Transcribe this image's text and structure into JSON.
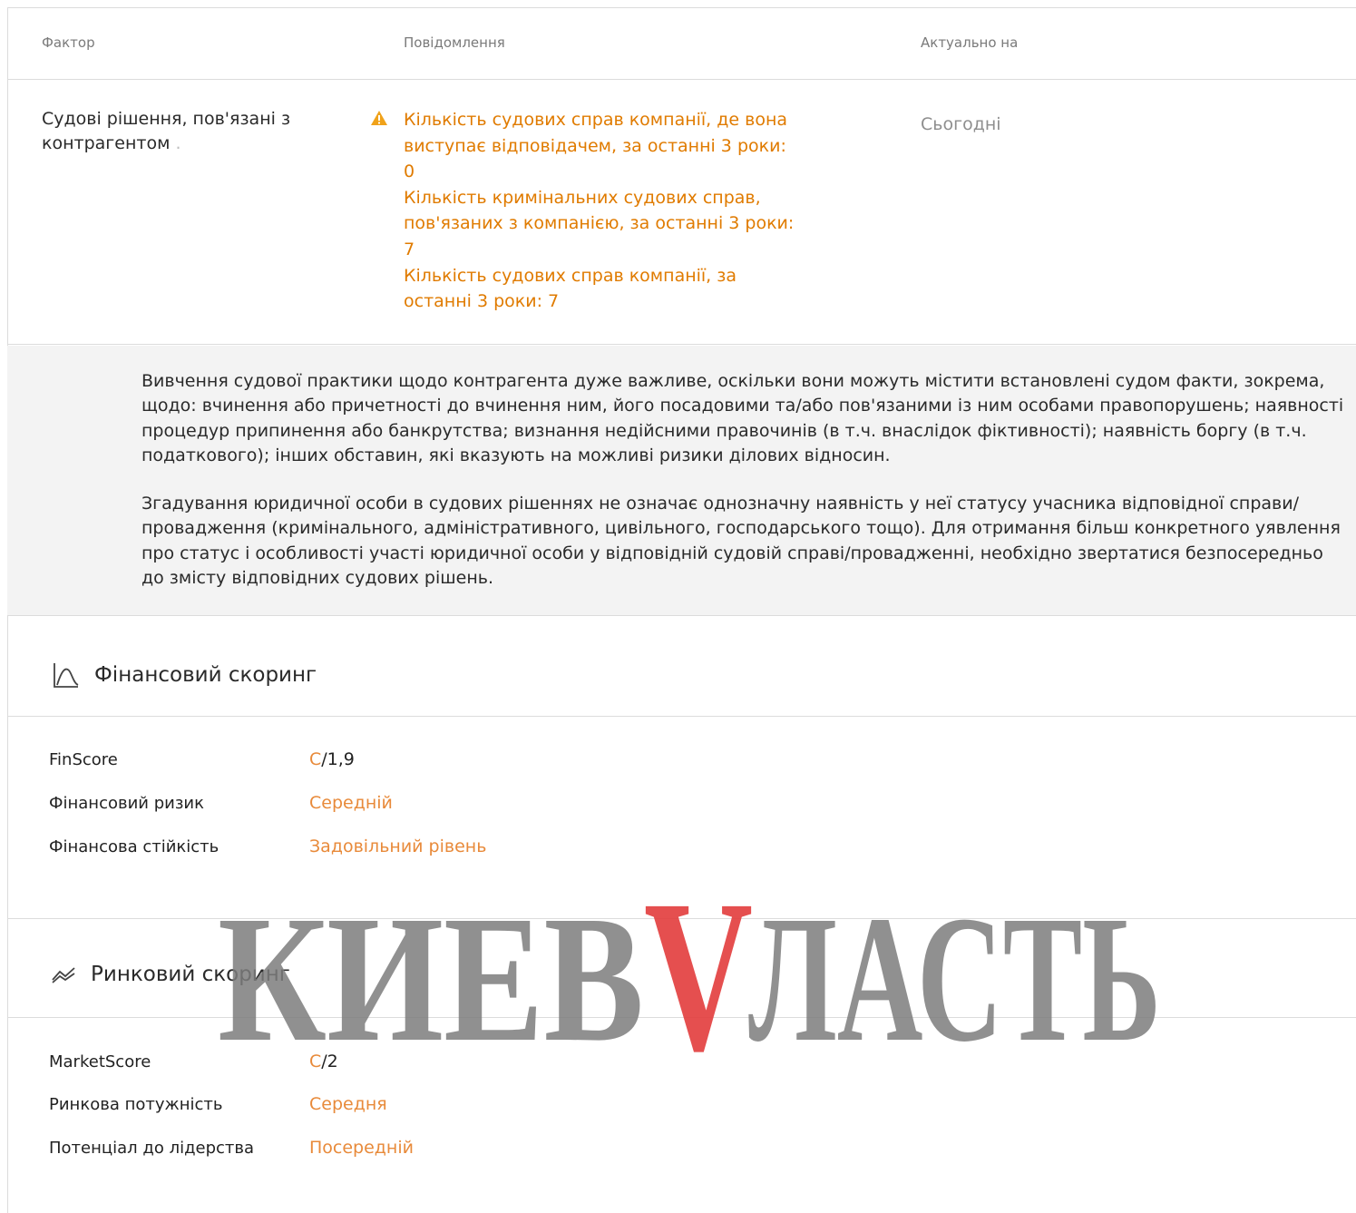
{
  "table": {
    "headers": {
      "factor": "Фактор",
      "message": "Повідомлення",
      "date": "Актуально на"
    },
    "row": {
      "factor": "Судові рішення, пов'язані з контрагентом",
      "factor_dot": ".",
      "messages": [
        "Кількість судових справ компанії, де вона\nвиступає відповідачем, за останні 3 роки:\n0",
        "Кількість кримінальних судових справ,\nпов'язаних з компанією, за останні 3 роки:\n7",
        "Кількість судових справ компанії, за\nостанні 3 роки: 7"
      ],
      "date": "Сьогодні"
    }
  },
  "note": {
    "p1": "Вивчення судової практики щодо контрагента дуже важливе, оскільки вони можуть містити встановлені судом факти, зокрема, щодо: вчинення або причетності до вчинення ним, його посадовими та/або пов'язаними із ним особами правопорушень; наявності процедур припинення або банкрутства; визнання недійсними правочинів (в т.ч. внаслідок фіктивності); наявність боргу (в т.ч. податкового); інших обставин, які вказують на можливі ризики ділових відносин.",
    "p2": "Згадування юридичної особи в судових рішеннях не означає однозначну наявність у неї статусу учасника відповідної справи/провадження (кримінального, адміністративного, цивільного, господарського тощо). Для отримання більш конкретного уявлення про статус і особливості участі юридичної особи у відповідній судовій справі/провадженні, необхідно звертатися безпосередньо до змісту відповідних судових рішень."
  },
  "financial": {
    "title": "Фінансовий скоринг",
    "icon": "chart-curve-icon",
    "items": [
      {
        "label": "FinScore",
        "grade": "C",
        "rest": "/1,9"
      },
      {
        "label": "Фінансовий ризик",
        "grade": "Середній",
        "rest": ""
      },
      {
        "label": "Фінансова стійкість",
        "grade": "Задовільний рівень",
        "rest": ""
      }
    ]
  },
  "market": {
    "title": "Ринковий скоринг",
    "icon": "trend-icon",
    "items": [
      {
        "label": "MarketScore",
        "grade": "C",
        "rest": "/2"
      },
      {
        "label": "Ринкова потужність",
        "grade": "Середня",
        "rest": ""
      },
      {
        "label": "Потенціал до лідерства",
        "grade": "Посередній",
        "rest": ""
      }
    ]
  },
  "watermark": {
    "left": "КИЕВ",
    "accent": "V",
    "right": "ЛАСТЬ",
    "colors": {
      "text": "#7d7d7d",
      "accent": "#e23c3c"
    }
  },
  "colors": {
    "accent": "#e07b00",
    "grade": "#e88a3a",
    "border": "#dcdcdc",
    "note_bg": "#f3f3f3"
  }
}
